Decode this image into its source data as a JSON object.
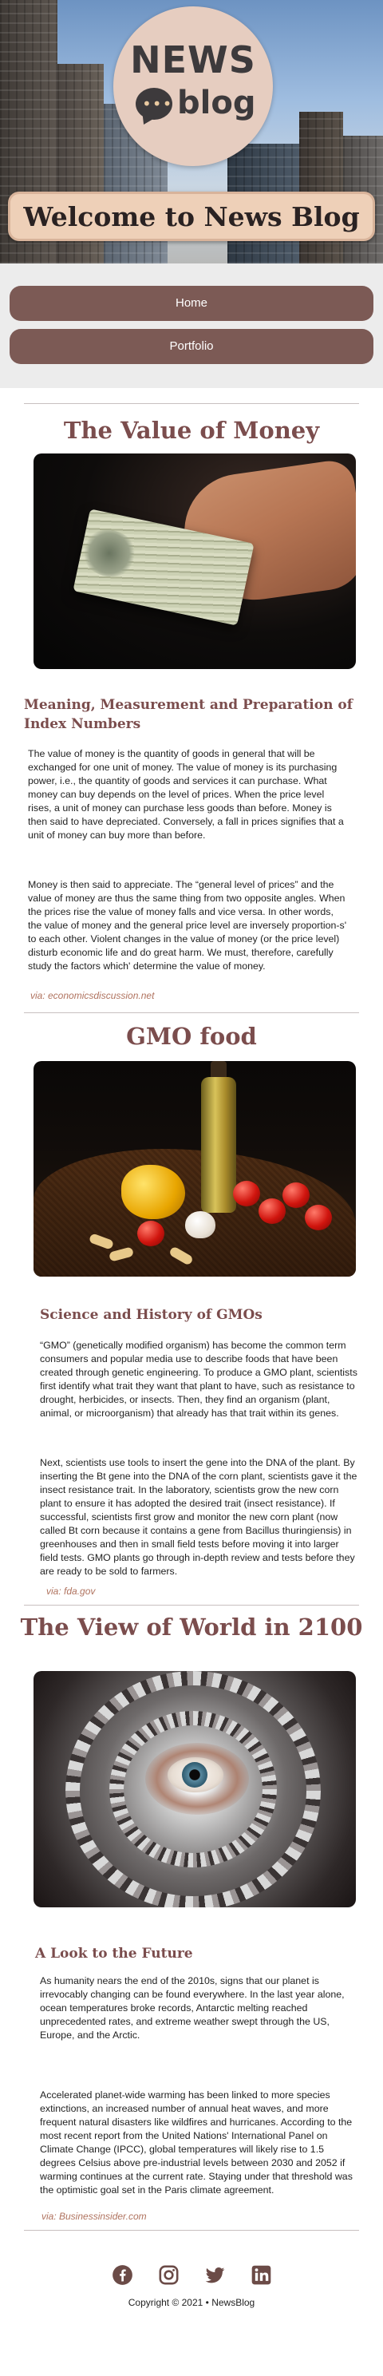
{
  "site": {
    "logo_news": "NEWS",
    "logo_blog": "blog",
    "welcome": "Welcome to News Blog"
  },
  "nav": {
    "items": [
      {
        "label": "Home"
      },
      {
        "label": "Portfolio"
      }
    ]
  },
  "articles": [
    {
      "title": "The Value of Money",
      "image": "money-in-hand-photo",
      "subtitle": "Meaning, Measurement and Preparation of Index Numbers",
      "paragraphs": [
        "The value of money is the quantity of goods in general that will be exchanged for one unit of money. The value of money is its purchasing power, i.e., the quantity of goods and services it can purchase. What money can buy depends on the level of prices. When the price level rises, a unit of money can purchase less goods than before. Money is then said to have depreciated. Conversely, a fall in prices signifies that a unit of money can buy more than before.",
        "Money is then said to appreciate. The “general level of prices” and the value of money are thus the same thing from two opposite angles. When the prices rise the value of money falls and vice versa. In other words, the value of money and the general price level are inversely proportion-s' to each other. Violent changes in the value of money (or the price level) disturb economic life and do great harm. We must, therefore, carefully study the factors which' determine the value of money."
      ],
      "source": "via: economicsdiscussion.net"
    },
    {
      "title": "GMO food",
      "image": "olive-oil-vegetables-photo",
      "subtitle": "Science and History of GMOs",
      "paragraphs": [
        "“GMO” (genetically modified organism) has become the common term consumers and popular media use to describe foods that have been created through genetic engineering. To produce a GMO plant, scientists first identify what trait they want that plant to have, such as resistance to drought, herbicides, or insects. Then, they find an organism (plant, animal, or microorganism) that already has that trait within its genes.",
        "Next, scientists use tools to insert the gene into the DNA of the plant. By inserting the Bt gene into the DNA of the corn plant, scientists gave it the insect resistance trait. In the laboratory, scientists grow the new corn plant to ensure it has adopted the desired trait (insect resistance). If successful, scientists first grow and monitor the new corn plant (now called Bt corn because it contains a gene from Bacillus thuringiensis) in greenhouses and then in small field tests before moving it into larger field tests. GMO plants go through in-depth review and tests before they are ready to be sold to farmers."
      ],
      "source": "via: fda.gov"
    },
    {
      "title": "The View of World in 2100",
      "image": "eye-in-newspaper-swirl-photo",
      "subtitle": "A Look to the Future",
      "paragraphs": [
        "As humanity nears the end of the 2010s, signs that our planet is irrevocably changing can be found everywhere. In the last year alone, ocean temperatures broke records, Antarctic melting reached unprecedented rates, and extreme weather swept through the US, Europe, and the Arctic.",
        "Accelerated planet-wide warming has been linked to more species extinctions, an increased number of annual heat waves, and more frequent natural disasters like wildfires and hurricanes. According to the most recent report from the United Nations' International Panel on Climate Change (IPCC), global temperatures will likely rise to 1.5 degrees Celsius above pre-industrial levels between 2030 and 2052 if warming continues at the current rate. Staying under that threshold was the optimistic goal set in the Paris climate agreement."
      ],
      "source": "via: Businessinsider.com"
    }
  ],
  "footer": {
    "social": [
      "facebook-icon",
      "instagram-icon",
      "twitter-icon",
      "linkedin-icon"
    ],
    "copyright": "Copyright © 2021 • NewsBlog"
  },
  "colors": {
    "accent": "#7b4d4d",
    "nav_button": "#7c5a55",
    "banner": "#eed0b8",
    "source_link": "#b0735f"
  }
}
